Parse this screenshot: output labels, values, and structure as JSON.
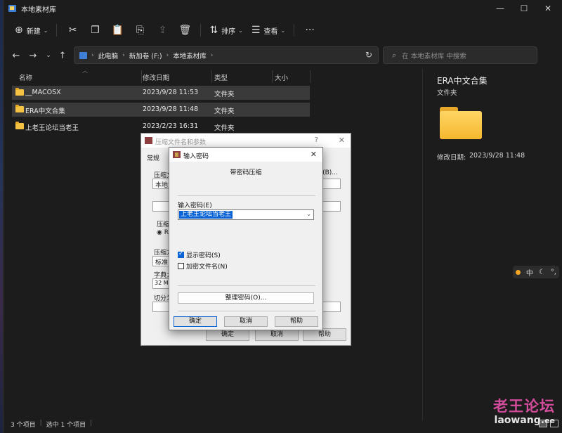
{
  "window": {
    "title": "本地素材库",
    "minimize": "—",
    "maximize": "☐",
    "close": "✕"
  },
  "toolbar": {
    "new_label": "新建",
    "sort_label": "排序",
    "view_label": "查看",
    "more": "···"
  },
  "address": {
    "crumbs": [
      "此电脑",
      "新加卷 (F:)",
      "本地素材库"
    ],
    "search_placeholder": "在 本地素材库 中搜索"
  },
  "columns": {
    "name": "名称",
    "modified": "修改日期",
    "type": "类型",
    "size": "大小"
  },
  "files": [
    {
      "name": "__MACOSX",
      "modified": "2023/9/28 11:53",
      "type": "文件夹"
    },
    {
      "name": "ERA中文合集",
      "modified": "2023/9/28 11:48",
      "type": "文件夹"
    },
    {
      "name": "上老王论坛当老王",
      "modified": "2023/2/23 16:31",
      "type": "文件夹"
    }
  ],
  "details": {
    "name": "ERA中文合集",
    "type": "文件夹",
    "modified_label": "修改日期:",
    "modified_value": "2023/9/28 11:48"
  },
  "status": {
    "count": "3 个项目",
    "selected": "选中 1 个项目"
  },
  "ime": {
    "mode": "中",
    "moon": "☾",
    "punct": "°,"
  },
  "watermark": {
    "cn": "老王论坛",
    "en": "laowang.",
    "tld": "ee"
  },
  "archive_dialog": {
    "title": "压缩文件名和参数",
    "tab": "常规",
    "filename_label": "压缩文",
    "filename_value": "本地素",
    "browse": "(B)...",
    "format_label": "压缩",
    "format_option": "RA",
    "method_label": "压缩方",
    "method_value": "标准",
    "dict_label": "字典大",
    "dict_value": "32 MB",
    "split_label": "切分为",
    "ok": "确定",
    "cancel": "取消",
    "help": "帮助"
  },
  "password_dialog": {
    "title": "输入密码",
    "heading": "带密码压缩",
    "password_label": "输入密码(E)",
    "password_value": "上老王论坛当老王",
    "show_password": "显示密码(S)",
    "show_password_checked": true,
    "encrypt_names": "加密文件名(N)",
    "encrypt_names_checked": false,
    "organize": "整理密码(O)...",
    "ok": "确定",
    "cancel": "取消",
    "help": "帮助"
  },
  "colors": {
    "accent": "#0a64d6",
    "folder": "#f6c244",
    "watermark": "#d24c9b"
  }
}
